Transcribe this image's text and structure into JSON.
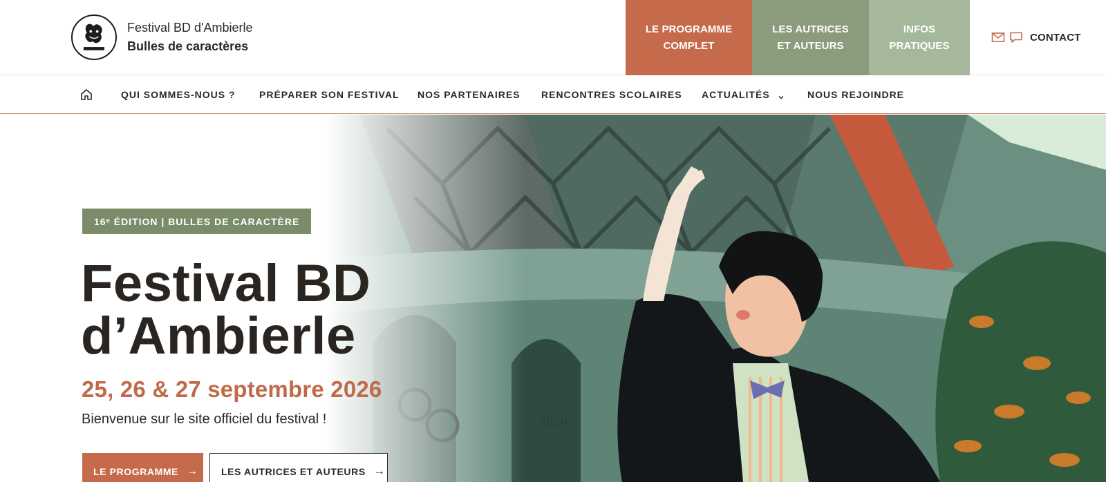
{
  "brand": {
    "logo_icon": "festival-logo-icon",
    "name": "Festival BD d'Ambierle",
    "tagline": "Bulles de caractères"
  },
  "header_tiles": [
    {
      "line1": "LE PROGRAMME",
      "line2": "COMPLET",
      "color": "#c56b4b"
    },
    {
      "line1": "LES AUTRICES",
      "line2": "ET AUTEURS",
      "color": "#8b9c7c"
    },
    {
      "line1": "INFOS",
      "line2": "PRATIQUES",
      "color": "#a6b89c"
    }
  ],
  "contact": {
    "label": "CONTACT",
    "icons": [
      "mail-icon",
      "chat-icon"
    ]
  },
  "nav": {
    "home_icon": "home-icon",
    "items": [
      {
        "label": "QUI SOMMES-NOUS ?"
      },
      {
        "label": "PRÉPARER SON FESTIVAL"
      },
      {
        "label": "NOS PARTENAIRES"
      },
      {
        "label": "RENCONTRES SCOLAIRES"
      },
      {
        "label": "ACTUALITÉS",
        "dropdown": true
      },
      {
        "label": "NOUS REJOINDRE"
      }
    ]
  },
  "hero": {
    "badge": "16ᵉ ÉDITION | BULLES DE CARACTÈRE",
    "title_line1": "Festival BD",
    "title_line2": "d’Ambierle",
    "date": "25, 26 & 27 septembre 2026",
    "welcome": "Bienvenue sur le site officiel du festival !",
    "primary_button": "LE PROGRAMME",
    "secondary_button": "LES AUTRICES ET AUTEURS",
    "art_watermark": "2026"
  },
  "colors": {
    "terracotta": "#c56b4b",
    "sage": "#8b9c7c",
    "light_sage": "#a6b89c",
    "badge_green": "#7a8c69",
    "date_orange": "#c06a4a",
    "text_dark": "#2b2825"
  }
}
